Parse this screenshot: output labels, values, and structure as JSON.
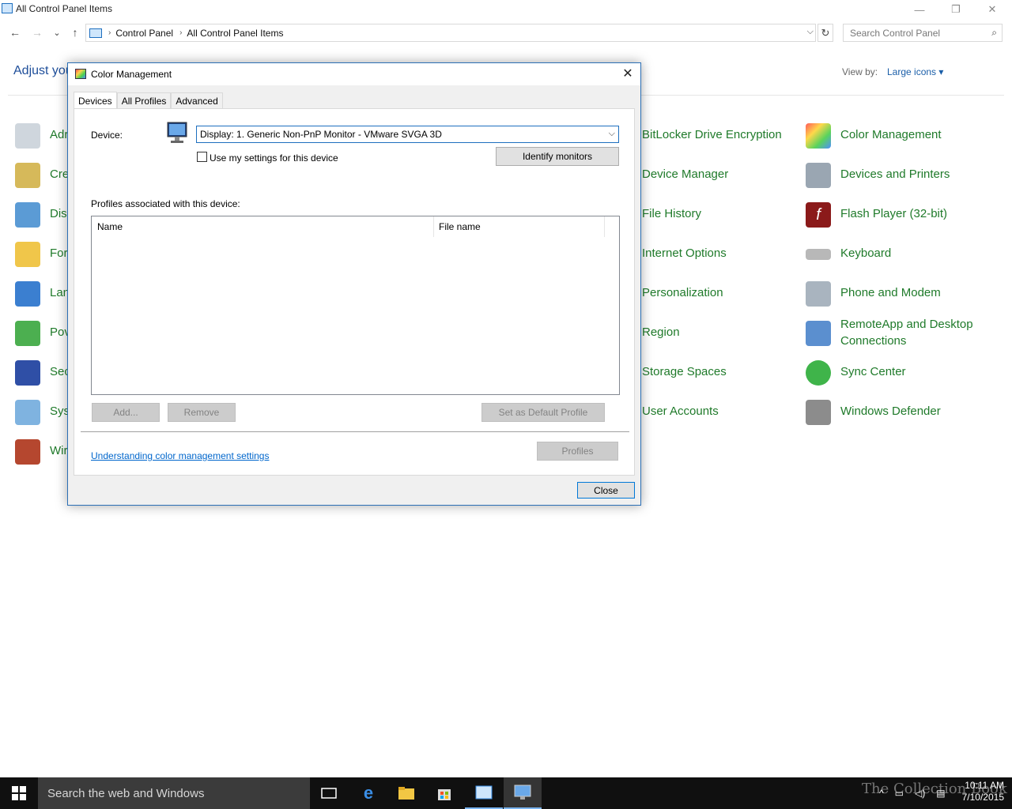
{
  "window": {
    "title": "All Control Panel Items",
    "controls": {
      "minimize": "—",
      "restore": "❐",
      "close": "✕"
    }
  },
  "navigation": {
    "back": "←",
    "forward": "→",
    "recent": "⌄",
    "up": "↑",
    "breadcrumb": [
      "Control Panel",
      "All Control Panel Items"
    ],
    "refresh": "↻",
    "search_placeholder": "Search Control Panel"
  },
  "main": {
    "heading": "Adjust you",
    "view_by_label": "View by:",
    "view_by_value": "Large icons ▾",
    "left_column_partial": [
      "Adr",
      "Cre",
      "Dis",
      "For",
      "Lan",
      "Pov",
      "Sec",
      "Sys",
      "Wir"
    ],
    "column3": [
      "BitLocker Drive Encryption",
      "Device Manager",
      "File History",
      "Internet Options",
      "Personalization",
      "Region",
      "Storage Spaces",
      "User Accounts"
    ],
    "column4": [
      "Color Management",
      "Devices and Printers",
      "Flash Player (32-bit)",
      "Keyboard",
      "Phone and Modem",
      "RemoteApp and Desktop Connections",
      "Sync Center",
      "Windows Defender"
    ]
  },
  "dialog": {
    "title": "Color Management",
    "close": "✕",
    "tabs": [
      "Devices",
      "All Profiles",
      "Advanced"
    ],
    "device_label": "Device:",
    "device_value": "Display: 1. Generic Non-PnP Monitor - VMware SVGA 3D",
    "use_settings_label": "Use my settings for this device",
    "identify_button": "Identify monitors",
    "profiles_label": "Profiles associated with this device:",
    "columns": [
      "Name",
      "File name"
    ],
    "add_button": "Add...",
    "remove_button": "Remove",
    "set_default_button": "Set as Default Profile",
    "link": "Understanding color management settings",
    "profiles_button": "Profiles",
    "close_button": "Close"
  },
  "taskbar": {
    "search_text": "Search the web and Windows",
    "time": "10:11 AM",
    "date": "7/10/2015",
    "watermark": "The Collection Book"
  },
  "colors": {
    "link": "#0066cc",
    "item_text": "#1f7a2a",
    "heading": "#1e4e9a",
    "dialog_border": "#2b6fb5",
    "taskbar": "#101010"
  }
}
